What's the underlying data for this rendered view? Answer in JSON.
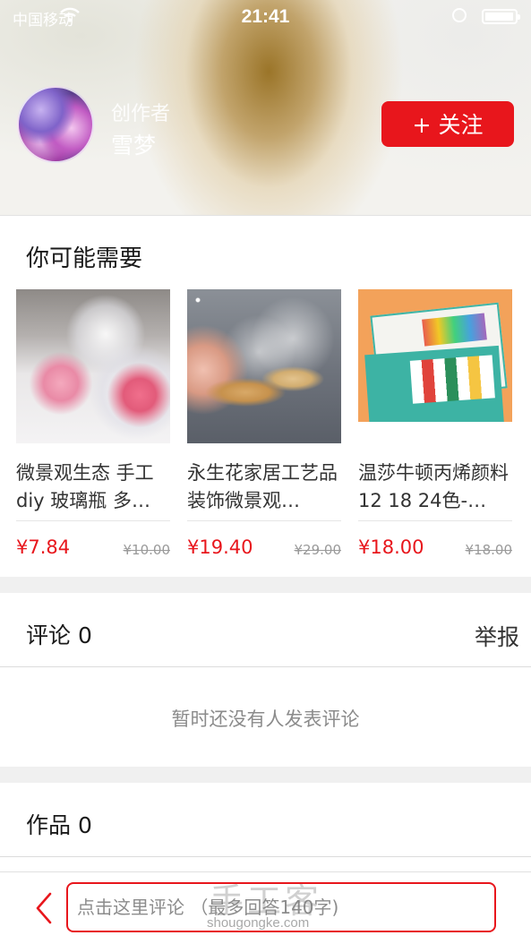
{
  "status_bar": {
    "carrier": "中国移动",
    "time": "21:41"
  },
  "author": {
    "role": "创作者",
    "name": "雪梦",
    "follow_label": "+ 关注"
  },
  "recommendations": {
    "title": "你可能需要",
    "products": [
      {
        "name": "微景观生态 手工diy 玻璃瓶 多…",
        "price": "¥7.84",
        "original_price": "¥10.00"
      },
      {
        "name": "永生花家居工艺品装饰微景观…",
        "price": "¥19.40",
        "original_price": "¥29.00"
      },
      {
        "name": "温莎牛顿丙烯颜料12 18 24色-…",
        "price": "¥18.00",
        "original_price": "¥18.00"
      }
    ]
  },
  "comments": {
    "title": "评论 0",
    "report_label": "举报",
    "empty_text": "暂时还没有人发表评论"
  },
  "works": {
    "title": "作品 0"
  },
  "bottom_bar": {
    "placeholder": "点击这里评论 （最多回答140字)"
  },
  "watermark": {
    "cn": "手工客",
    "en": "shougongke.com"
  },
  "colors": {
    "accent": "#e8161c",
    "section_gap": "#f0f0f0"
  }
}
